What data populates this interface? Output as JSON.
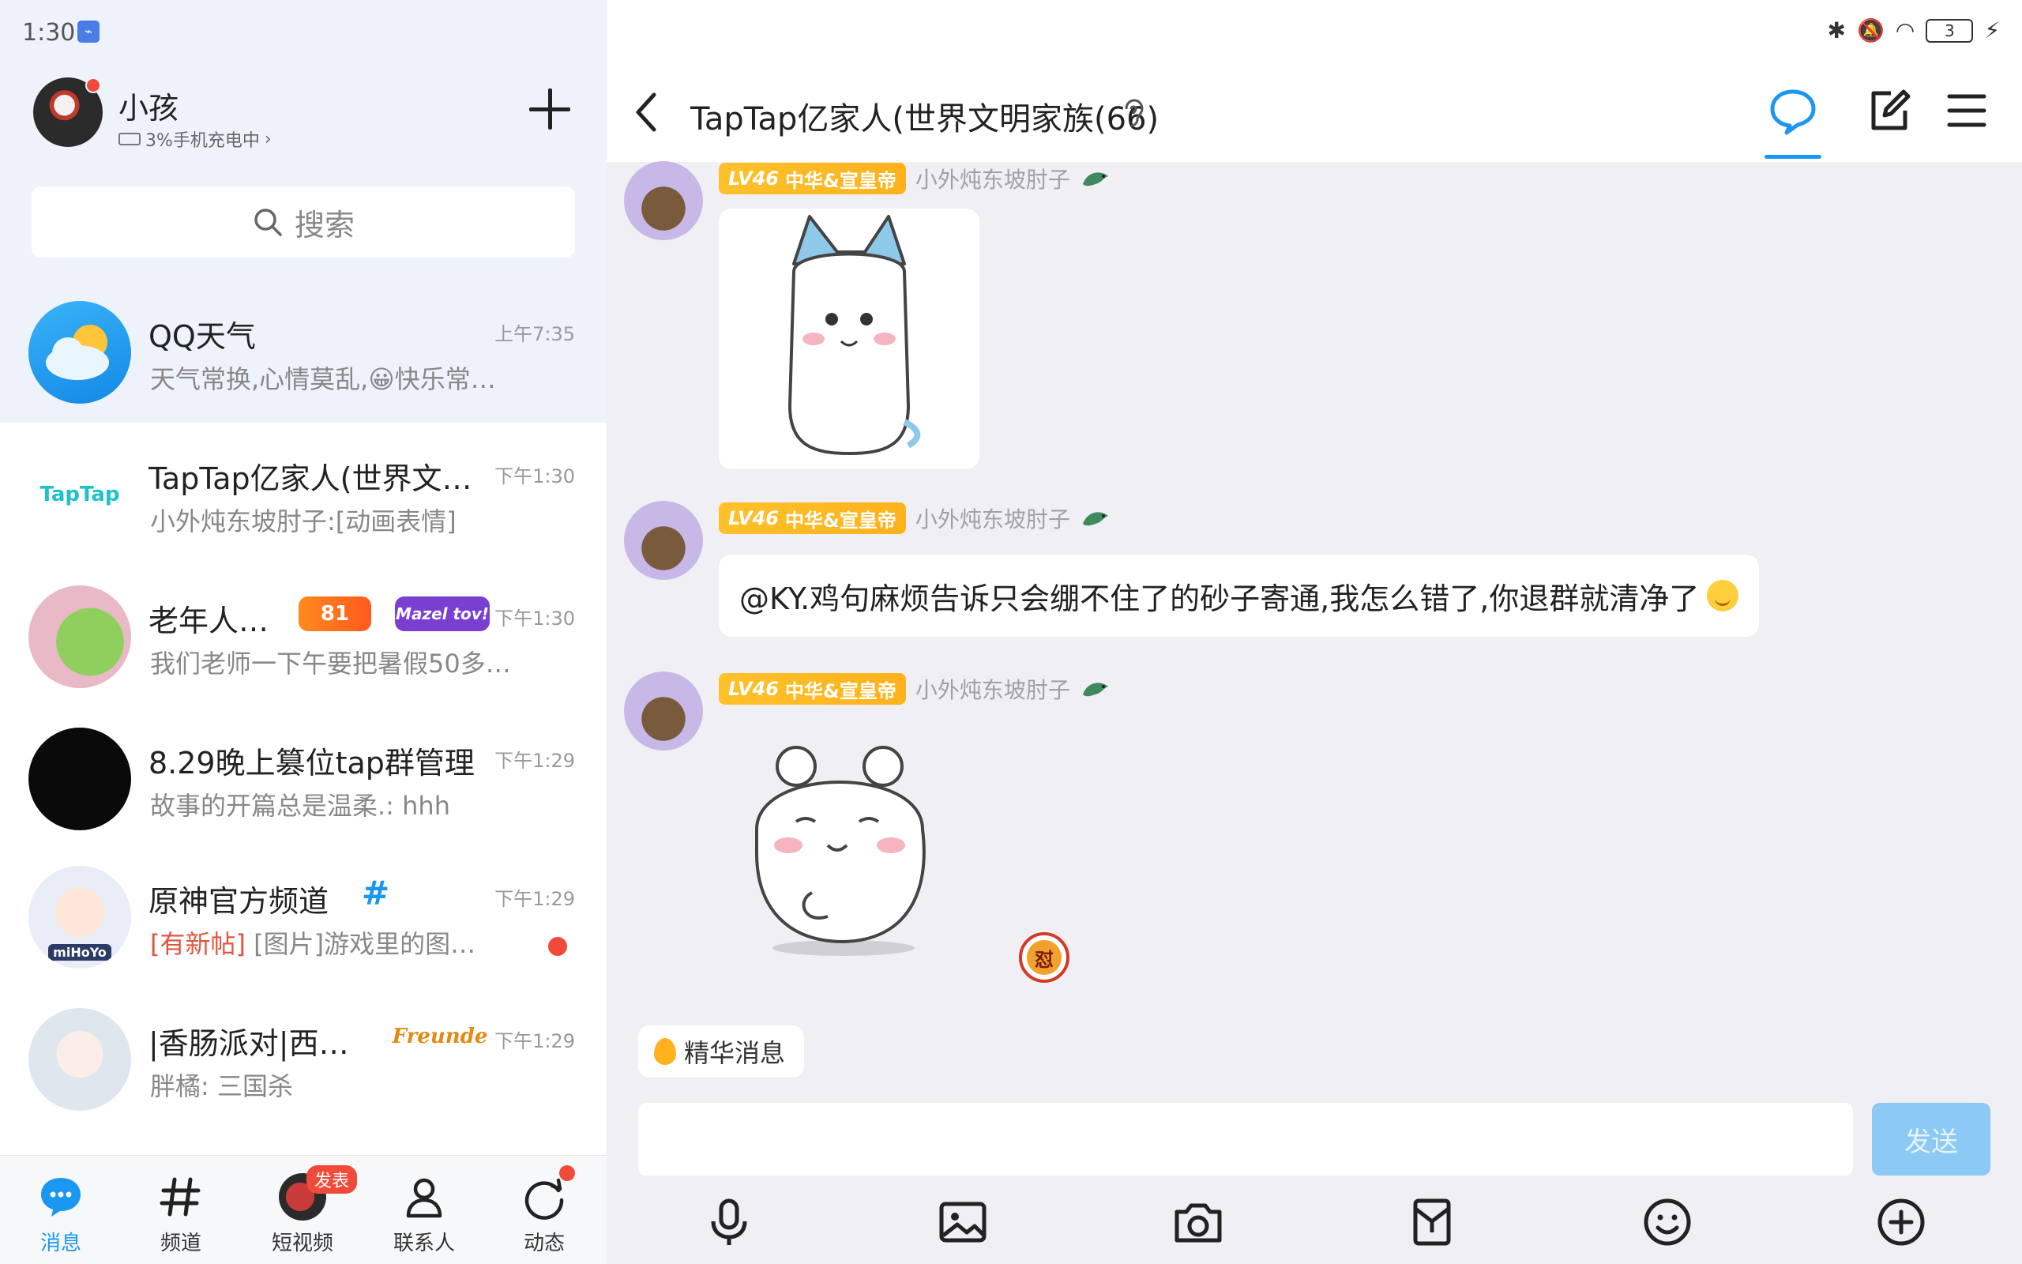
{
  "status_bar": {
    "time": "1:30",
    "battery": "3"
  },
  "me": {
    "name": "小孩",
    "status": "3%手机充电中"
  },
  "search": {
    "placeholder": "搜索"
  },
  "conversations": [
    {
      "title": "QQ天气",
      "time": "上午7:35",
      "subtitle": "天气常换,心情莫乱,😀快乐常…"
    },
    {
      "title": "TapTap亿家人(世界文…",
      "time": "下午1:30",
      "subtitle": "小外炖东坡肘子:[动画表情]",
      "avatar_text": "TapTap"
    },
    {
      "title": "老年人…",
      "time": "下午1:30",
      "subtitle": "我们老师一下午要把暑假50多…",
      "badges": [
        "81",
        "Mazel tov!"
      ]
    },
    {
      "title": "8.29晚上篡位tap群管理",
      "time": "下午1:29",
      "subtitle": "故事的开篇总是温柔.: hhh"
    },
    {
      "title": "原神官方频道",
      "time": "下午1:29",
      "subtitle_tag": "[有新帖]",
      "subtitle": "[图片]游戏里的图…",
      "avatar_text": "miHoYo"
    },
    {
      "title": "|香肠派对|西…",
      "time": "下午1:29",
      "subtitle": "胖橘: 三国杀",
      "badges": [
        "Freunde"
      ]
    }
  ],
  "tabbar": [
    {
      "label": "消息"
    },
    {
      "label": "频道"
    },
    {
      "label": "短视频",
      "badge": "发表"
    },
    {
      "label": "联系人"
    },
    {
      "label": "动态"
    }
  ],
  "chat": {
    "title": "TapTap亿家人(世界文明家族(66)",
    "messages": [
      {
        "level": "LV46",
        "title_tag": "中华&宣皇帝",
        "nickname": "小外炖东坡肘子",
        "type": "sticker"
      },
      {
        "level": "LV46",
        "title_tag": "中华&宣皇帝",
        "nickname": "小外炖东坡肘子",
        "type": "text",
        "text": "@KY.鸡句麻烦告诉只会绷不住了的砂子寄通,我怎么错了,你退群就清净了"
      },
      {
        "level": "LV46",
        "title_tag": "中华&宣皇帝",
        "nickname": "小外炖东坡肘子",
        "type": "sticker",
        "reaction": "怼"
      }
    ],
    "essence_label": "精华消息",
    "send_label": "发送"
  },
  "colors": {
    "accent": "#1a97f0",
    "level_tag": "#ffc12a",
    "unread": "#f04b3a"
  }
}
